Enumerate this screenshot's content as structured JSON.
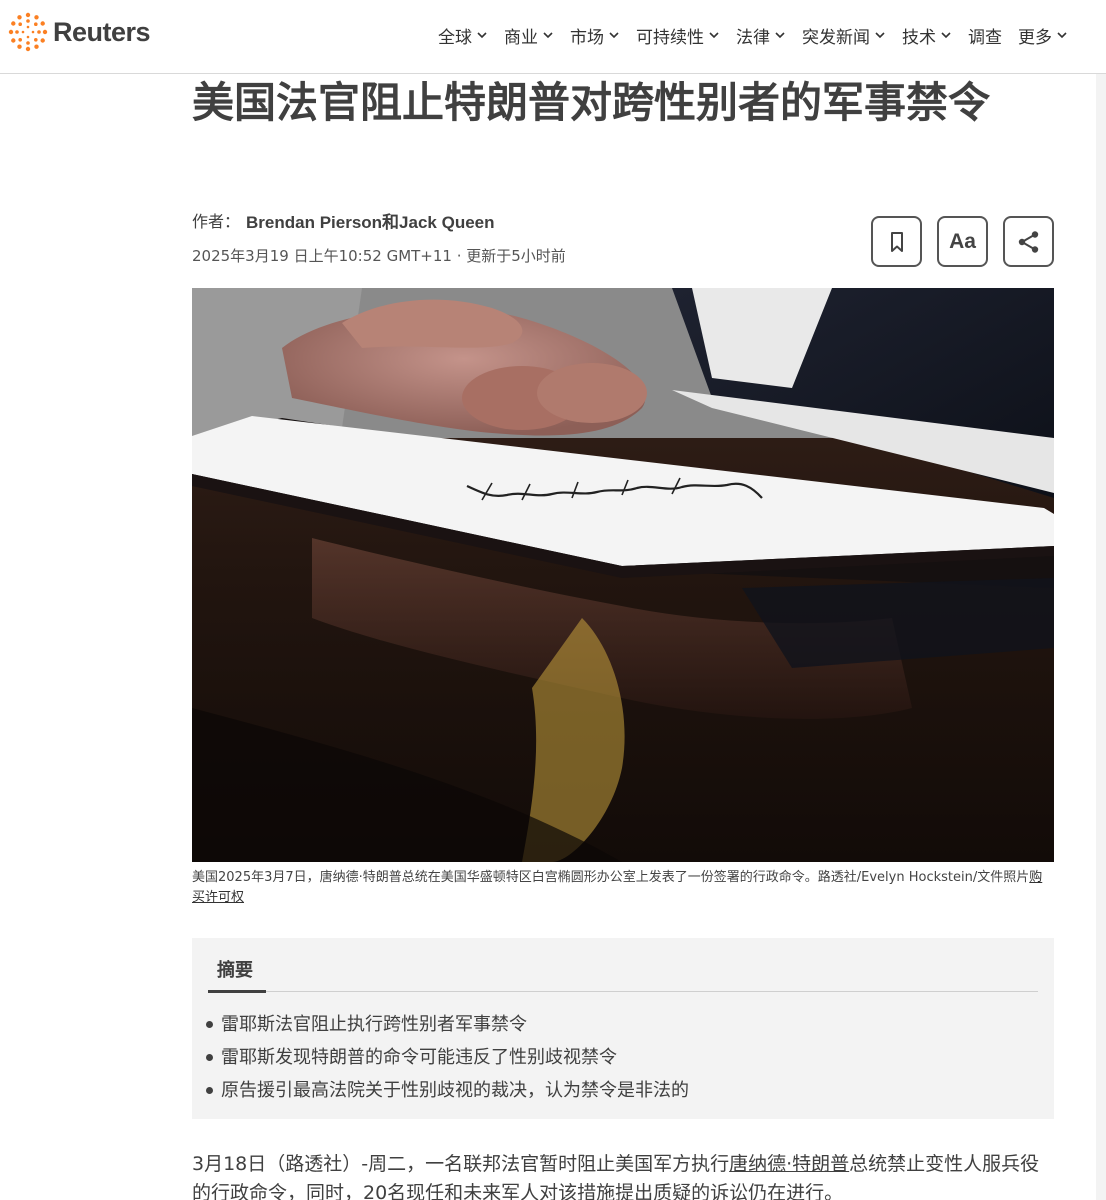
{
  "brand": {
    "name": "Reuters",
    "accent": "#fb8023"
  },
  "nav": {
    "items": [
      {
        "label": "全球",
        "has_dropdown": true
      },
      {
        "label": "商业",
        "has_dropdown": true
      },
      {
        "label": "市场",
        "has_dropdown": true
      },
      {
        "label": "可持续性",
        "has_dropdown": true
      },
      {
        "label": "法律",
        "has_dropdown": true
      },
      {
        "label": "突发新闻",
        "has_dropdown": true
      },
      {
        "label": "技术",
        "has_dropdown": true
      },
      {
        "label": "调查",
        "has_dropdown": false
      },
      {
        "label": "更多",
        "has_dropdown": true
      }
    ]
  },
  "article": {
    "title": "美国法官阻止特朗普对跨性别者的军事禁令",
    "byline_prefix": "作者：",
    "authors": "Brendan Pierson和Jack Queen",
    "dateline": "2025年3月19 日上午10:52 GMT+11 · 更新于5小时前",
    "tools": {
      "bookmark_icon": "bookmark-icon",
      "font_size_label": "Aa",
      "share_icon": "share-icon"
    },
    "image_caption": "美国2025年3月7日，唐纳德·特朗普总统在美国华盛顿特区白宫椭圆形办公室上发表了一份签署的行政命令。路透社/Evelyn Hockstein/文件照片",
    "image_license_link": "购买许可权",
    "summary": {
      "title": "摘要",
      "items": [
        "雷耶斯法官阻止执行跨性别者军事禁令",
        "雷耶斯发现特朗普的命令可能违反了性别歧视禁令",
        "原告援引最高法院关于性别歧视的裁决，认为禁令是非法的"
      ]
    },
    "body": {
      "p1_before": "3月18日（路透社）-周二，一名联邦法官暂时阻止美国军方执行",
      "p1_link": "唐纳德·特朗普",
      "p1_after": "总统禁止变性人服兵役的行政命令，同时，20名现任和未来军人对该措施提出质疑的诉讼仍在进行。"
    }
  }
}
